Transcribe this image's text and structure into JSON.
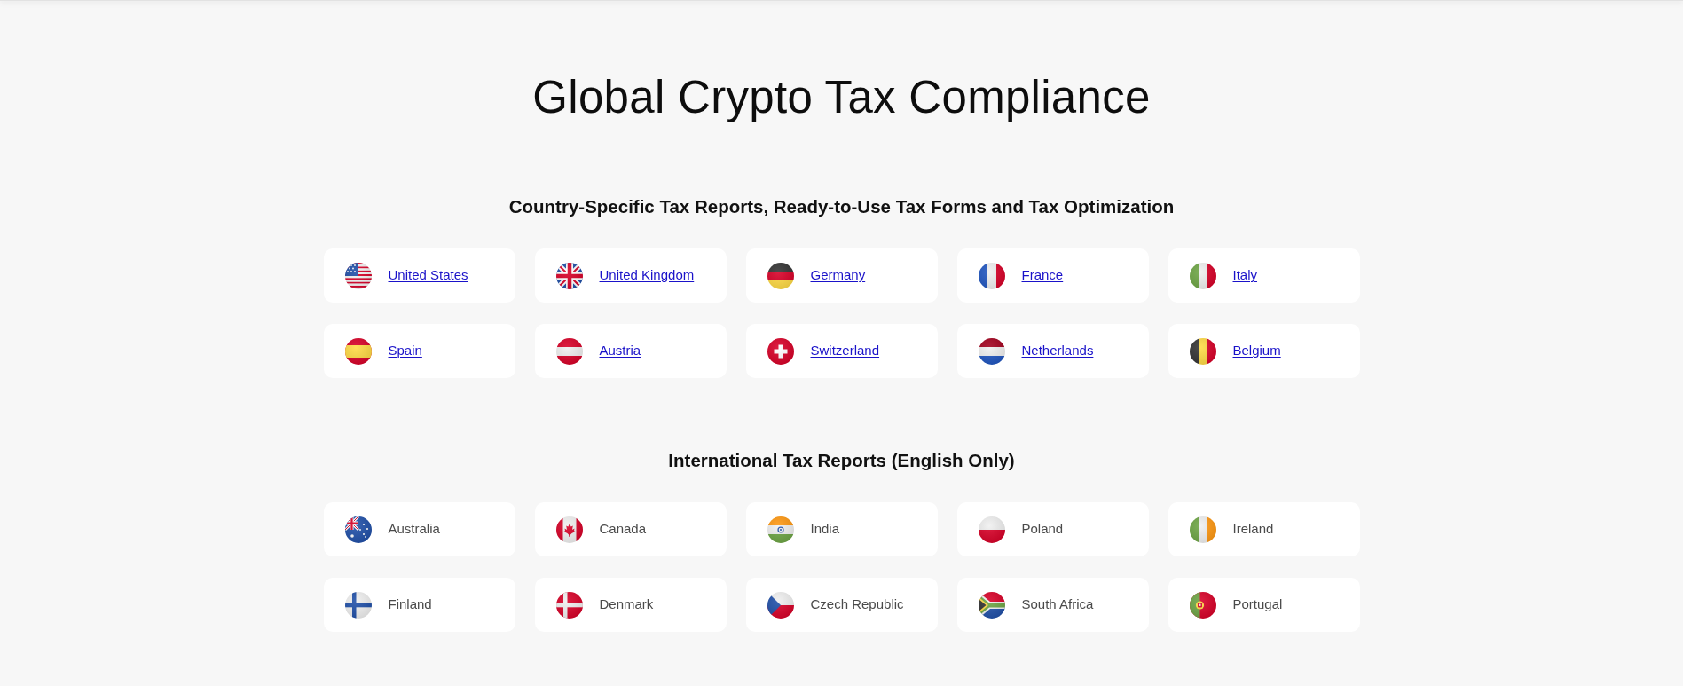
{
  "title": "Global Crypto Tax Compliance",
  "sections": [
    {
      "heading": "Country-Specific Tax Reports, Ready-to-Use Tax Forms and Tax Optimization",
      "countries": [
        {
          "name": "United States",
          "kind": "link"
        },
        {
          "name": "United Kingdom",
          "kind": "link"
        },
        {
          "name": "Germany",
          "kind": "link"
        },
        {
          "name": "France",
          "kind": "link"
        },
        {
          "name": "Italy",
          "kind": "link"
        },
        {
          "name": "Spain",
          "kind": "link"
        },
        {
          "name": "Austria",
          "kind": "link"
        },
        {
          "name": "Switzerland",
          "kind": "link"
        },
        {
          "name": "Netherlands",
          "kind": "link"
        },
        {
          "name": "Belgium",
          "kind": "link"
        }
      ]
    },
    {
      "heading": "International Tax Reports (English Only)",
      "countries": [
        {
          "name": "Australia",
          "kind": "plain"
        },
        {
          "name": "Canada",
          "kind": "plain"
        },
        {
          "name": "India",
          "kind": "plain"
        },
        {
          "name": "Poland",
          "kind": "plain"
        },
        {
          "name": "Ireland",
          "kind": "plain"
        },
        {
          "name": "Finland",
          "kind": "plain"
        },
        {
          "name": "Denmark",
          "kind": "plain"
        },
        {
          "name": "Czech Republic",
          "kind": "plain"
        },
        {
          "name": "South Africa",
          "kind": "plain"
        },
        {
          "name": "Portugal",
          "kind": "plain"
        }
      ]
    }
  ]
}
